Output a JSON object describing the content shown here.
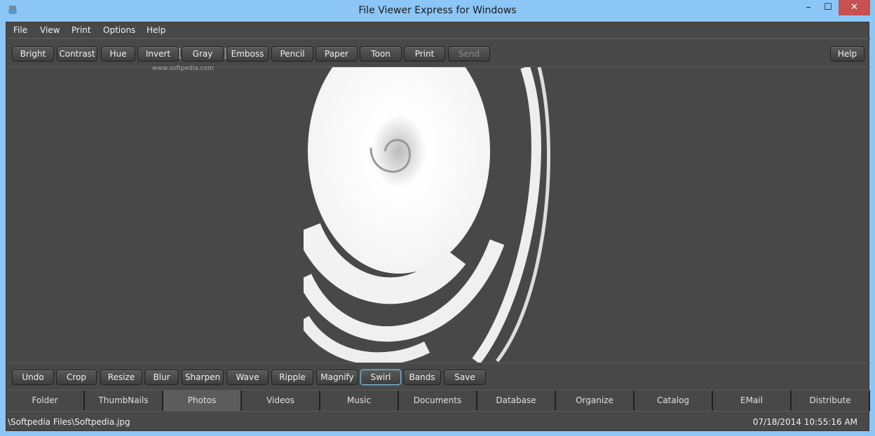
{
  "window": {
    "title": "File Viewer Express for Windows",
    "minimize": "–",
    "maximize": "☐",
    "close": "✕"
  },
  "menu": [
    "File",
    "View",
    "Print",
    "Options",
    "Help"
  ],
  "top_toolbar": [
    "Bright",
    "Contrast",
    "Hue",
    "Invert",
    "Gray",
    "Emboss",
    "Pencil",
    "Paper",
    "Toon",
    "Print",
    "Send"
  ],
  "help_button": "Help",
  "bottom_toolbar": [
    "Undo",
    "Crop",
    "Resize",
    "Blur",
    "Sharpen",
    "Wave",
    "Ripple",
    "Magnify",
    "Swirl",
    "Bands",
    "Save"
  ],
  "tabs": [
    "Folder",
    "ThumbNails",
    "Photos",
    "Videos",
    "Music",
    "Documents",
    "Database",
    "Organize",
    "Catalog",
    "EMail",
    "Distribute"
  ],
  "selected_tab": "Photos",
  "active_effect": "Swirl",
  "disabled_buttons": [
    "Send"
  ],
  "status": {
    "path": "\\Softpedia Files\\Softpedia.jpg",
    "datetime": "07/18/2014 10:55:16 AM"
  },
  "watermark": {
    "logo": "SOFTPEDIA",
    "url": "www.softpedia.com"
  },
  "colors": {
    "titlebar": "#8cc6f6",
    "background": "#484848",
    "close": "#c75050",
    "active_border": "#7ab8d8"
  }
}
